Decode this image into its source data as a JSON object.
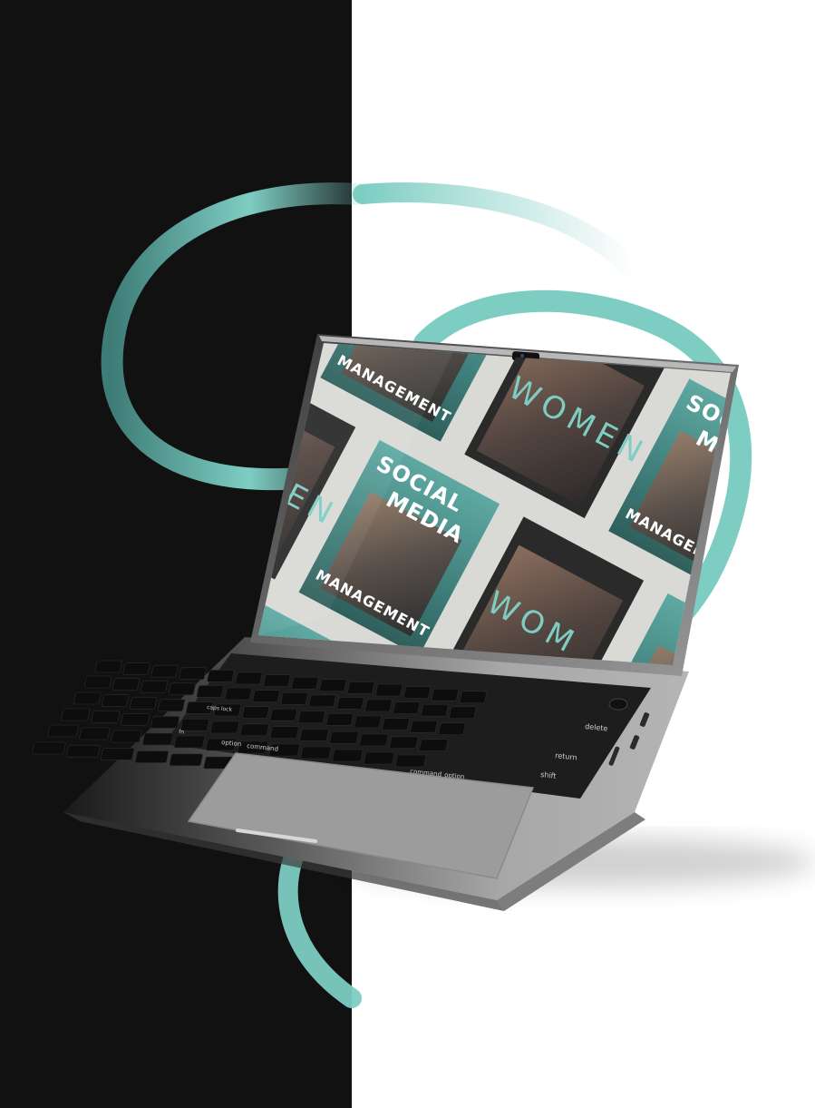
{
  "colors": {
    "left_panel": "#111111",
    "right_panel": "#ffffff",
    "accent_ring": "#7ecdc3",
    "laptop_body": "#8f8f8f",
    "screen_background": "#d9d9d6",
    "poster_teal": "#5fa9a3"
  },
  "screen": {
    "posters": [
      {
        "line1": "SOCIAL",
        "line2": "MEDIA",
        "line3": "MANAGEMENT"
      },
      {
        "script": "WOMEN"
      },
      {
        "line1": "SOCIAL",
        "line2": "MEDIA",
        "line3": "MANAGEMENT"
      },
      {
        "script": "WOMEN"
      },
      {
        "line1": "SOCIAL",
        "line2": "MEDIA",
        "line3": "MANAGEMENT"
      },
      {
        "script": "WOM"
      },
      {
        "line3": "MANAGEMENT"
      },
      {
        "script": "N"
      }
    ]
  },
  "keyboard": {
    "labels": {
      "delete": "delete",
      "return": "return",
      "shift": "shift",
      "command_left": "command",
      "option_left": "option",
      "command_right": "command",
      "option_right": "option",
      "caps_lock": "caps lock",
      "fn": "fn"
    }
  }
}
